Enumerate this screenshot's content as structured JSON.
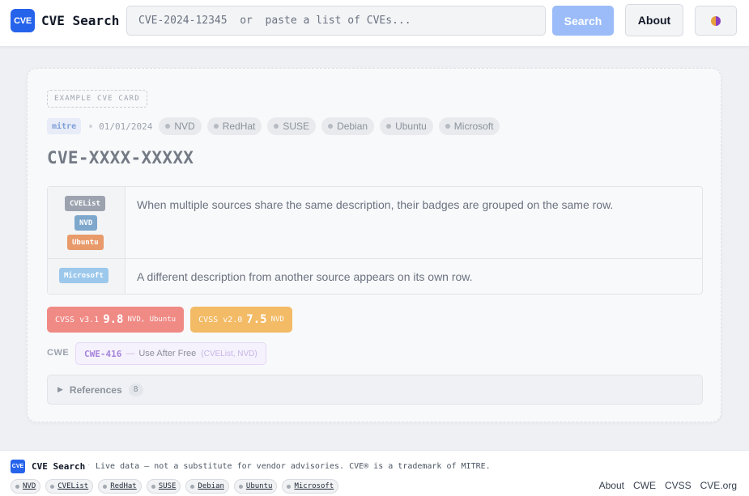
{
  "header": {
    "logo_text": "CVE",
    "app_title": "CVE Search",
    "search_placeholder": "CVE-2024-12345  or  paste a list of CVEs...",
    "search_label": "Search",
    "about_label": "About",
    "theme_icon": "theme-toggle-icon"
  },
  "card": {
    "example_label": "EXAMPLE CVE CARD",
    "source": "mitre",
    "date": "01/01/2024",
    "vendors": [
      "NVD",
      "RedHat",
      "SUSE",
      "Debian",
      "Ubuntu",
      "Microsoft"
    ],
    "cve_id": "CVE-XXXX-XXXXX",
    "descriptions": [
      {
        "sources": [
          "CVEList",
          "NVD",
          "Ubuntu"
        ],
        "text": "When multiple sources share the same description, their badges are grouped on the same row."
      },
      {
        "sources": [
          "Microsoft"
        ],
        "text": "A different description from another source appears on its own row."
      }
    ],
    "cvss": [
      {
        "version": "CVSS v3.1",
        "score": "9.8",
        "sources": "NVD, Ubuntu",
        "color": "#f08a85"
      },
      {
        "version": "CVSS v2.0",
        "score": "7.5",
        "sources": "NVD",
        "color": "#f3bb66"
      }
    ],
    "cwe_label": "CWE",
    "cwe": {
      "id": "CWE-416",
      "separator": "—",
      "name": "Use After Free",
      "sources": "(CVEList, NVD)"
    },
    "references_label": "References",
    "references_count": "8",
    "badge_colors": {
      "CVEList": "#9ca3af",
      "NVD": "#7ea7cc",
      "Ubuntu": "#e89a6a",
      "Microsoft": "#9cc8ec"
    }
  },
  "footer": {
    "logo_text": "CVE",
    "title": "CVE Search",
    "separator": "·",
    "note": "Live data — not a substitute for vendor advisories. CVE® is a trademark of MITRE.",
    "links": [
      "NVD",
      "CVEList",
      "RedHat",
      "SUSE",
      "Debian",
      "Ubuntu",
      "Microsoft"
    ],
    "nav": [
      "About",
      "CWE",
      "CVSS",
      "CVE.org"
    ]
  }
}
